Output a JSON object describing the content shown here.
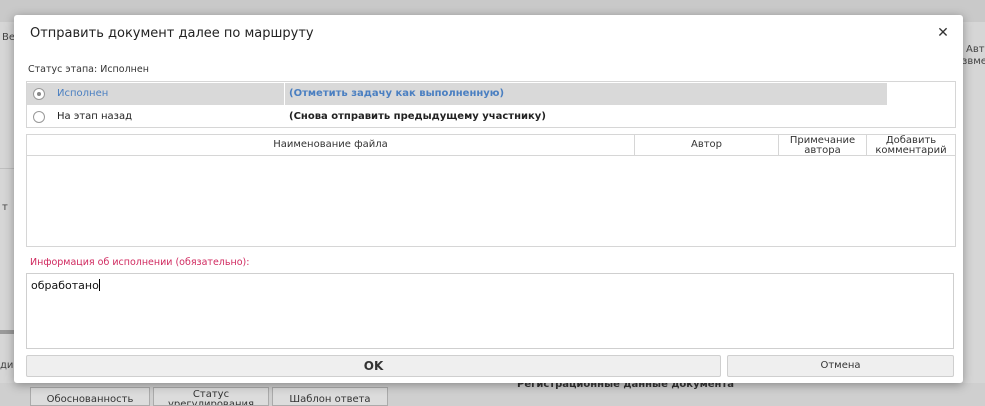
{
  "background": {
    "left_fragments": [
      "Вер",
      "т",
      "ди"
    ],
    "right_fragments": [
      "Авто",
      "звмен"
    ],
    "bottom_buttons": [
      "Обоснованность",
      "Статус урегулирования",
      "Шаблон ответа"
    ],
    "section_title": "Регистрационные данные документа"
  },
  "dialog": {
    "title": "Отправить документ далее по маршруту",
    "close_icon": "close-icon",
    "status_label": "Статус этапа: Исполнен",
    "options": [
      {
        "name": "Исполнен",
        "description": "(Отметить задачу как выполненную)",
        "selected": true
      },
      {
        "name": "На этап назад",
        "description": "(Снова отправить предыдущему участнику)",
        "selected": false
      }
    ],
    "files_table": {
      "columns": [
        "Наименование файла",
        "Автор",
        "Примечание автора",
        "Добавить комментарий"
      ],
      "rows": []
    },
    "info_label": "Информация об исполнении (обязательно):",
    "info_value": "обработано",
    "ok_label": "OK",
    "cancel_label": "Отмена"
  },
  "colors": {
    "accent_blue": "#4a7fc1",
    "required_red": "#d0295f",
    "selected_row_bg": "#d9d9d9"
  }
}
